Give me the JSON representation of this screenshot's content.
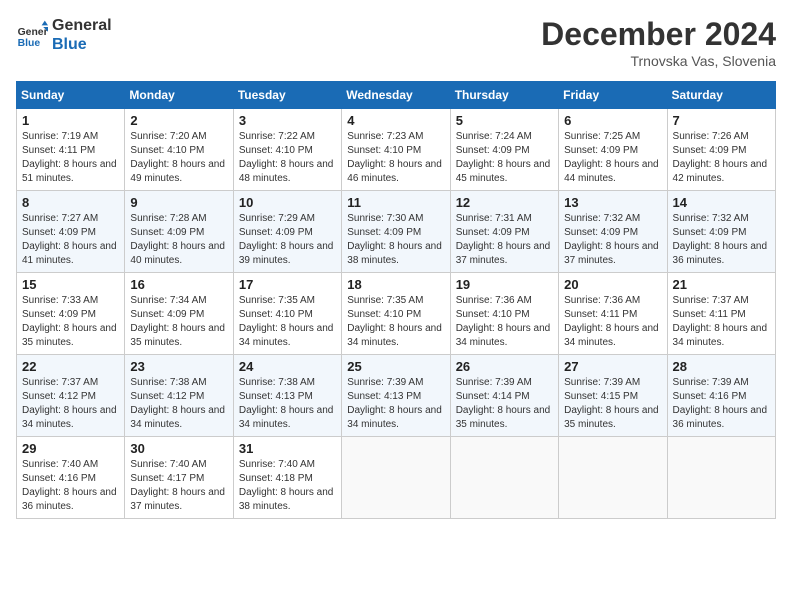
{
  "header": {
    "logo_line1": "General",
    "logo_line2": "Blue",
    "month_title": "December 2024",
    "location": "Trnovska Vas, Slovenia"
  },
  "weekdays": [
    "Sunday",
    "Monday",
    "Tuesday",
    "Wednesday",
    "Thursday",
    "Friday",
    "Saturday"
  ],
  "weeks": [
    [
      {
        "day": "1",
        "sunrise": "7:19 AM",
        "sunset": "4:11 PM",
        "daylight": "8 hours and 51 minutes."
      },
      {
        "day": "2",
        "sunrise": "7:20 AM",
        "sunset": "4:10 PM",
        "daylight": "8 hours and 49 minutes."
      },
      {
        "day": "3",
        "sunrise": "7:22 AM",
        "sunset": "4:10 PM",
        "daylight": "8 hours and 48 minutes."
      },
      {
        "day": "4",
        "sunrise": "7:23 AM",
        "sunset": "4:10 PM",
        "daylight": "8 hours and 46 minutes."
      },
      {
        "day": "5",
        "sunrise": "7:24 AM",
        "sunset": "4:09 PM",
        "daylight": "8 hours and 45 minutes."
      },
      {
        "day": "6",
        "sunrise": "7:25 AM",
        "sunset": "4:09 PM",
        "daylight": "8 hours and 44 minutes."
      },
      {
        "day": "7",
        "sunrise": "7:26 AM",
        "sunset": "4:09 PM",
        "daylight": "8 hours and 42 minutes."
      }
    ],
    [
      {
        "day": "8",
        "sunrise": "7:27 AM",
        "sunset": "4:09 PM",
        "daylight": "8 hours and 41 minutes."
      },
      {
        "day": "9",
        "sunrise": "7:28 AM",
        "sunset": "4:09 PM",
        "daylight": "8 hours and 40 minutes."
      },
      {
        "day": "10",
        "sunrise": "7:29 AM",
        "sunset": "4:09 PM",
        "daylight": "8 hours and 39 minutes."
      },
      {
        "day": "11",
        "sunrise": "7:30 AM",
        "sunset": "4:09 PM",
        "daylight": "8 hours and 38 minutes."
      },
      {
        "day": "12",
        "sunrise": "7:31 AM",
        "sunset": "4:09 PM",
        "daylight": "8 hours and 37 minutes."
      },
      {
        "day": "13",
        "sunrise": "7:32 AM",
        "sunset": "4:09 PM",
        "daylight": "8 hours and 37 minutes."
      },
      {
        "day": "14",
        "sunrise": "7:32 AM",
        "sunset": "4:09 PM",
        "daylight": "8 hours and 36 minutes."
      }
    ],
    [
      {
        "day": "15",
        "sunrise": "7:33 AM",
        "sunset": "4:09 PM",
        "daylight": "8 hours and 35 minutes."
      },
      {
        "day": "16",
        "sunrise": "7:34 AM",
        "sunset": "4:09 PM",
        "daylight": "8 hours and 35 minutes."
      },
      {
        "day": "17",
        "sunrise": "7:35 AM",
        "sunset": "4:10 PM",
        "daylight": "8 hours and 34 minutes."
      },
      {
        "day": "18",
        "sunrise": "7:35 AM",
        "sunset": "4:10 PM",
        "daylight": "8 hours and 34 minutes."
      },
      {
        "day": "19",
        "sunrise": "7:36 AM",
        "sunset": "4:10 PM",
        "daylight": "8 hours and 34 minutes."
      },
      {
        "day": "20",
        "sunrise": "7:36 AM",
        "sunset": "4:11 PM",
        "daylight": "8 hours and 34 minutes."
      },
      {
        "day": "21",
        "sunrise": "7:37 AM",
        "sunset": "4:11 PM",
        "daylight": "8 hours and 34 minutes."
      }
    ],
    [
      {
        "day": "22",
        "sunrise": "7:37 AM",
        "sunset": "4:12 PM",
        "daylight": "8 hours and 34 minutes."
      },
      {
        "day": "23",
        "sunrise": "7:38 AM",
        "sunset": "4:12 PM",
        "daylight": "8 hours and 34 minutes."
      },
      {
        "day": "24",
        "sunrise": "7:38 AM",
        "sunset": "4:13 PM",
        "daylight": "8 hours and 34 minutes."
      },
      {
        "day": "25",
        "sunrise": "7:39 AM",
        "sunset": "4:13 PM",
        "daylight": "8 hours and 34 minutes."
      },
      {
        "day": "26",
        "sunrise": "7:39 AM",
        "sunset": "4:14 PM",
        "daylight": "8 hours and 35 minutes."
      },
      {
        "day": "27",
        "sunrise": "7:39 AM",
        "sunset": "4:15 PM",
        "daylight": "8 hours and 35 minutes."
      },
      {
        "day": "28",
        "sunrise": "7:39 AM",
        "sunset": "4:16 PM",
        "daylight": "8 hours and 36 minutes."
      }
    ],
    [
      {
        "day": "29",
        "sunrise": "7:40 AM",
        "sunset": "4:16 PM",
        "daylight": "8 hours and 36 minutes."
      },
      {
        "day": "30",
        "sunrise": "7:40 AM",
        "sunset": "4:17 PM",
        "daylight": "8 hours and 37 minutes."
      },
      {
        "day": "31",
        "sunrise": "7:40 AM",
        "sunset": "4:18 PM",
        "daylight": "8 hours and 38 minutes."
      },
      null,
      null,
      null,
      null
    ]
  ]
}
